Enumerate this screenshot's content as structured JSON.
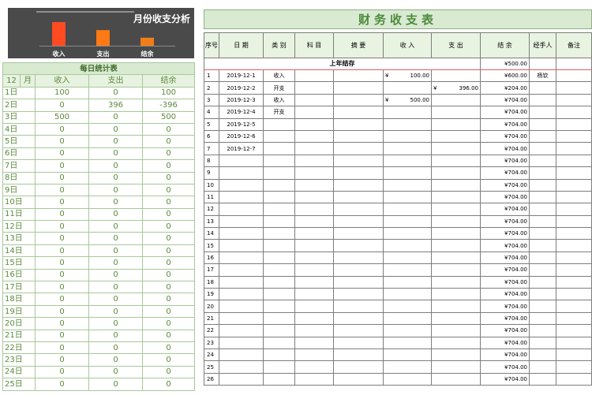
{
  "chart": {
    "title": "月份收支分析",
    "bars": [
      {
        "label": "收入",
        "value": 600,
        "color": "#ff4a22"
      },
      {
        "label": "支出",
        "value": 396,
        "color": "#ff7a14"
      },
      {
        "label": "结余",
        "value": 204,
        "color": "#f07d18"
      }
    ]
  },
  "daily": {
    "title": "每日统计表",
    "month": "12",
    "month_unit": "月",
    "columns": [
      "收入",
      "支出",
      "结余"
    ],
    "rows": [
      {
        "day": "1日",
        "income": "100",
        "expense": "0",
        "balance": "100"
      },
      {
        "day": "2日",
        "income": "0",
        "expense": "396",
        "balance": "-396"
      },
      {
        "day": "3日",
        "income": "500",
        "expense": "0",
        "balance": "500"
      },
      {
        "day": "4日",
        "income": "0",
        "expense": "0",
        "balance": "0"
      },
      {
        "day": "5日",
        "income": "0",
        "expense": "0",
        "balance": "0"
      },
      {
        "day": "6日",
        "income": "0",
        "expense": "0",
        "balance": "0"
      },
      {
        "day": "7日",
        "income": "0",
        "expense": "0",
        "balance": "0"
      },
      {
        "day": "8日",
        "income": "0",
        "expense": "0",
        "balance": "0"
      },
      {
        "day": "9日",
        "income": "0",
        "expense": "0",
        "balance": "0"
      },
      {
        "day": "10日",
        "income": "0",
        "expense": "0",
        "balance": "0"
      },
      {
        "day": "11日",
        "income": "0",
        "expense": "0",
        "balance": "0"
      },
      {
        "day": "12日",
        "income": "0",
        "expense": "0",
        "balance": "0"
      },
      {
        "day": "13日",
        "income": "0",
        "expense": "0",
        "balance": "0"
      },
      {
        "day": "14日",
        "income": "0",
        "expense": "0",
        "balance": "0"
      },
      {
        "day": "15日",
        "income": "0",
        "expense": "0",
        "balance": "0"
      },
      {
        "day": "16日",
        "income": "0",
        "expense": "0",
        "balance": "0"
      },
      {
        "day": "17日",
        "income": "0",
        "expense": "0",
        "balance": "0"
      },
      {
        "day": "18日",
        "income": "0",
        "expense": "0",
        "balance": "0"
      },
      {
        "day": "19日",
        "income": "0",
        "expense": "0",
        "balance": "0"
      },
      {
        "day": "20日",
        "income": "0",
        "expense": "0",
        "balance": "0"
      },
      {
        "day": "21日",
        "income": "0",
        "expense": "0",
        "balance": "0"
      },
      {
        "day": "22日",
        "income": "0",
        "expense": "0",
        "balance": "0"
      },
      {
        "day": "23日",
        "income": "0",
        "expense": "0",
        "balance": "0"
      },
      {
        "day": "24日",
        "income": "0",
        "expense": "0",
        "balance": "0"
      },
      {
        "day": "25日",
        "income": "0",
        "expense": "0",
        "balance": "0"
      }
    ]
  },
  "ledger": {
    "title": "财务收支表",
    "headers": {
      "seq": "序号",
      "date": "日 期",
      "category": "类 别",
      "subject": "科 目",
      "summary": "摘 要",
      "income": "收 入",
      "expense": "支 出",
      "balance": "结 余",
      "handler": "经手人",
      "note": "备注"
    },
    "prev_label": "上年结存",
    "prev_balance": "¥500.00",
    "currency": "¥",
    "rows": [
      {
        "seq": "1",
        "date": "2019-12-1",
        "category": "收入",
        "subject": "",
        "summary": "",
        "income": "100.00",
        "expense": "",
        "balance": "¥600.00",
        "handler": "杨钦",
        "note": ""
      },
      {
        "seq": "2",
        "date": "2019-12-2",
        "category": "开支",
        "subject": "",
        "summary": "",
        "income": "",
        "expense": "396.00",
        "balance": "¥204.00",
        "handler": "",
        "note": ""
      },
      {
        "seq": "3",
        "date": "2019-12-3",
        "category": "收入",
        "subject": "",
        "summary": "",
        "income": "500.00",
        "expense": "",
        "balance": "¥704.00",
        "handler": "",
        "note": ""
      },
      {
        "seq": "4",
        "date": "2019-12-4",
        "category": "开支",
        "subject": "",
        "summary": "",
        "income": "",
        "expense": "",
        "balance": "¥704.00",
        "handler": "",
        "note": ""
      },
      {
        "seq": "5",
        "date": "2019-12-5",
        "category": "",
        "subject": "",
        "summary": "",
        "income": "",
        "expense": "",
        "balance": "¥704.00",
        "handler": "",
        "note": ""
      },
      {
        "seq": "6",
        "date": "2019-12-6",
        "category": "",
        "subject": "",
        "summary": "",
        "income": "",
        "expense": "",
        "balance": "¥704.00",
        "handler": "",
        "note": ""
      },
      {
        "seq": "7",
        "date": "2019-12-7",
        "category": "",
        "subject": "",
        "summary": "",
        "income": "",
        "expense": "",
        "balance": "¥704.00",
        "handler": "",
        "note": ""
      },
      {
        "seq": "8",
        "date": "",
        "category": "",
        "subject": "",
        "summary": "",
        "income": "",
        "expense": "",
        "balance": "¥704.00",
        "handler": "",
        "note": ""
      },
      {
        "seq": "9",
        "date": "",
        "category": "",
        "subject": "",
        "summary": "",
        "income": "",
        "expense": "",
        "balance": "¥704.00",
        "handler": "",
        "note": ""
      },
      {
        "seq": "10",
        "date": "",
        "category": "",
        "subject": "",
        "summary": "",
        "income": "",
        "expense": "",
        "balance": "¥704.00",
        "handler": "",
        "note": ""
      },
      {
        "seq": "11",
        "date": "",
        "category": "",
        "subject": "",
        "summary": "",
        "income": "",
        "expense": "",
        "balance": "¥704.00",
        "handler": "",
        "note": ""
      },
      {
        "seq": "12",
        "date": "",
        "category": "",
        "subject": "",
        "summary": "",
        "income": "",
        "expense": "",
        "balance": "¥704.00",
        "handler": "",
        "note": ""
      },
      {
        "seq": "13",
        "date": "",
        "category": "",
        "subject": "",
        "summary": "",
        "income": "",
        "expense": "",
        "balance": "¥704.00",
        "handler": "",
        "note": ""
      },
      {
        "seq": "14",
        "date": "",
        "category": "",
        "subject": "",
        "summary": "",
        "income": "",
        "expense": "",
        "balance": "¥704.00",
        "handler": "",
        "note": ""
      },
      {
        "seq": "15",
        "date": "",
        "category": "",
        "subject": "",
        "summary": "",
        "income": "",
        "expense": "",
        "balance": "¥704.00",
        "handler": "",
        "note": ""
      },
      {
        "seq": "16",
        "date": "",
        "category": "",
        "subject": "",
        "summary": "",
        "income": "",
        "expense": "",
        "balance": "¥704.00",
        "handler": "",
        "note": ""
      },
      {
        "seq": "17",
        "date": "",
        "category": "",
        "subject": "",
        "summary": "",
        "income": "",
        "expense": "",
        "balance": "¥704.00",
        "handler": "",
        "note": ""
      },
      {
        "seq": "18",
        "date": "",
        "category": "",
        "subject": "",
        "summary": "",
        "income": "",
        "expense": "",
        "balance": "¥704.00",
        "handler": "",
        "note": ""
      },
      {
        "seq": "19",
        "date": "",
        "category": "",
        "subject": "",
        "summary": "",
        "income": "",
        "expense": "",
        "balance": "¥704.00",
        "handler": "",
        "note": ""
      },
      {
        "seq": "20",
        "date": "",
        "category": "",
        "subject": "",
        "summary": "",
        "income": "",
        "expense": "",
        "balance": "¥704.00",
        "handler": "",
        "note": ""
      },
      {
        "seq": "21",
        "date": "",
        "category": "",
        "subject": "",
        "summary": "",
        "income": "",
        "expense": "",
        "balance": "¥704.00",
        "handler": "",
        "note": ""
      },
      {
        "seq": "22",
        "date": "",
        "category": "",
        "subject": "",
        "summary": "",
        "income": "",
        "expense": "",
        "balance": "¥704.00",
        "handler": "",
        "note": ""
      },
      {
        "seq": "23",
        "date": "",
        "category": "",
        "subject": "",
        "summary": "",
        "income": "",
        "expense": "",
        "balance": "¥704.00",
        "handler": "",
        "note": ""
      },
      {
        "seq": "24",
        "date": "",
        "category": "",
        "subject": "",
        "summary": "",
        "income": "",
        "expense": "",
        "balance": "¥704.00",
        "handler": "",
        "note": ""
      },
      {
        "seq": "25",
        "date": "",
        "category": "",
        "subject": "",
        "summary": "",
        "income": "",
        "expense": "",
        "balance": "¥704.00",
        "handler": "",
        "note": ""
      },
      {
        "seq": "26",
        "date": "",
        "category": "",
        "subject": "",
        "summary": "",
        "income": "",
        "expense": "",
        "balance": "¥704.00",
        "handler": "",
        "note": ""
      }
    ]
  }
}
